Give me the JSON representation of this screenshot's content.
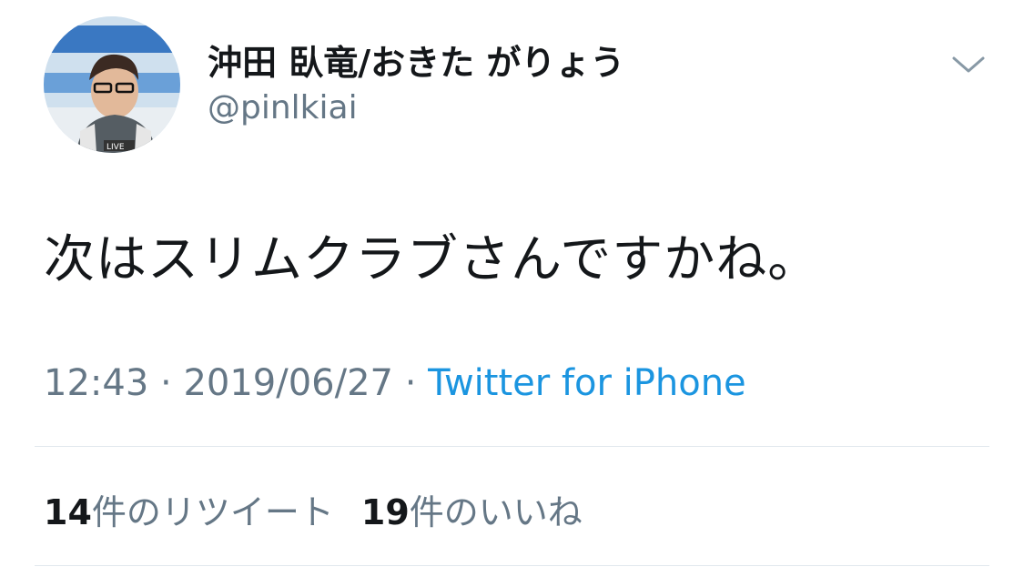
{
  "user": {
    "display_name": "沖田 臥竜/おきた がりょう",
    "handle": "@pinlkiai",
    "avatar_badge": "LIVE"
  },
  "tweet": {
    "text": "次はスリムクラブさんですかね。",
    "time": "12:43",
    "separator": "·",
    "date": "2019/06/27",
    "source": "Twitter for iPhone"
  },
  "stats": {
    "retweets_count": "14",
    "retweets_label": "件のリツイート",
    "likes_count": "19",
    "likes_label": "件のいいね"
  },
  "icons": {
    "menu": "chevron-down-icon"
  },
  "colors": {
    "text": "#14171a",
    "secondary": "#657786",
    "link": "#1b95e0",
    "divider": "#e1e8ed"
  }
}
